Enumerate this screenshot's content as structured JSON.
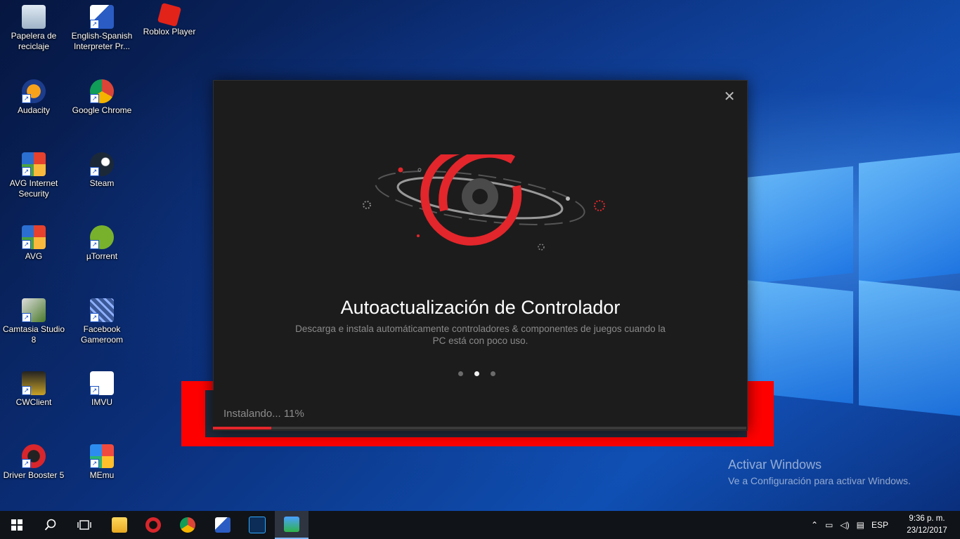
{
  "desktop": {
    "icons": [
      {
        "label": "Papelera de reciclaje"
      },
      {
        "label": "English-Spanish Interpreter Pr..."
      },
      {
        "label": "Roblox Player"
      },
      {
        "label": "Audacity"
      },
      {
        "label": "Google Chrome"
      },
      {
        "label": "AVG Internet Security"
      },
      {
        "label": "Steam"
      },
      {
        "label": "AVG"
      },
      {
        "label": "µTorrent"
      },
      {
        "label": "Camtasia Studio 8"
      },
      {
        "label": "Facebook Gameroom"
      },
      {
        "label": "CWClient"
      },
      {
        "label": "IMVU"
      },
      {
        "label": "Driver Booster 5"
      },
      {
        "label": "MEmu"
      }
    ],
    "watermark_title": "Activar Windows",
    "watermark_sub": "Ve a Configuración para activar Windows."
  },
  "dialog": {
    "close_glyph": "✕",
    "headline": "Autoactualización de Controlador",
    "description": "Descarga e instala automáticamente controladores & componentes de juegos cuando la PC está con poco uso.",
    "carousel_active_index": 1,
    "accent_color": "#e3262b"
  },
  "progress": {
    "text": "Instalando... 11%",
    "percent": 11
  },
  "taskbar": {
    "language": "ESP",
    "time": "9:36 p. m.",
    "date": "23/12/2017"
  }
}
